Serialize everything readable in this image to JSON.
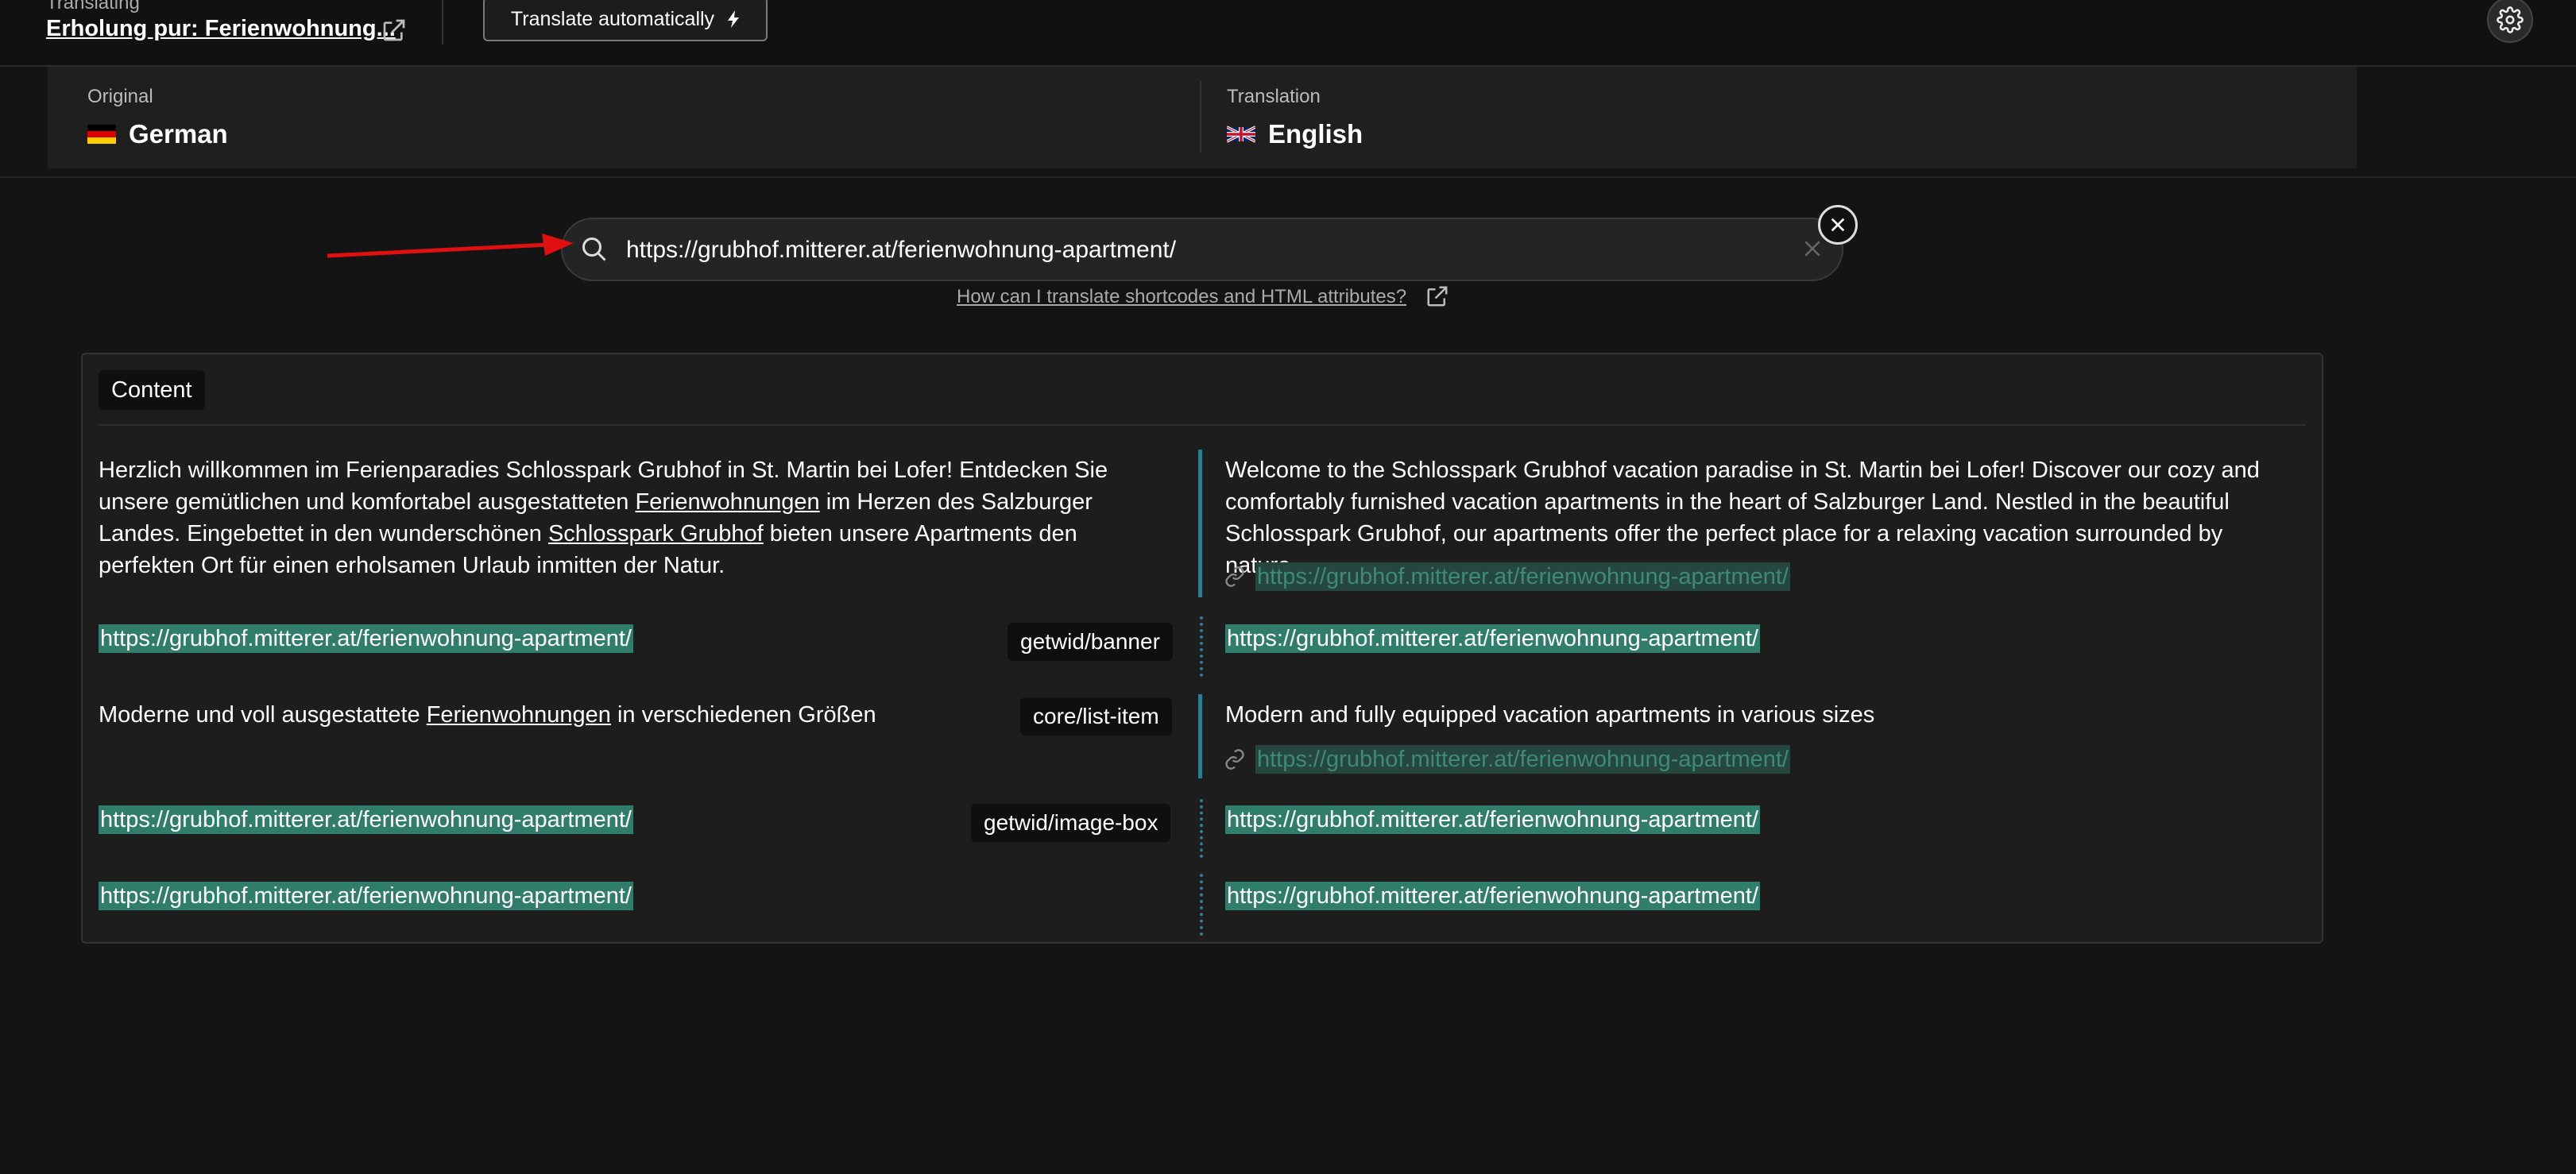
{
  "header": {
    "translating_label": "Translating",
    "page_title": "Erholung pur: Ferienwohnung...",
    "translate_automatically_label": "Translate automatically",
    "settings_icon": "gear-icon",
    "open_page_icon": "external-link-icon"
  },
  "languages": {
    "original_caption": "Original",
    "original_name": "German",
    "translation_caption": "Translation",
    "translation_name": "English"
  },
  "search": {
    "value": "https://grubhof.mitterer.at/ferienwohnung-apartment/",
    "help_link": "How can I translate shortcodes and HTML attributes?"
  },
  "content": {
    "tab_label": "Content",
    "rows": [
      {
        "original_parts": [
          "Herzlich willkommen im Ferienparadies Schlosspark Grubhof in St. Martin bei Lofer! Entdecken Sie unsere gemütlichen und komfortabel ausgestatteten ",
          "Ferienwohnungen",
          " im Herzen des Salzburger Landes. Eingebettet in den wunderschönen ",
          "Schlosspark Grubhof",
          " bieten unsere Apartments den perfekten Ort für einen erholsamen Urlaub inmitten der Natur."
        ],
        "translation": "Welcome to the Schlosspark Grubhof vacation paradise in St. Martin bei Lofer! Discover our cozy and comfortably furnished vacation apartments in the heart of Salzburger Land. Nestled in the beautiful Schlosspark Grubhof, our apartments offer the perfect place for a relaxing vacation surrounded by nature.",
        "translation_link": "https://grubhof.mitterer.at/ferienwohnung-apartment/"
      },
      {
        "tag": "getwid/banner",
        "original_url": "https://grubhof.mitterer.at/ferienwohnung-apartment/",
        "translation_url": "https://grubhof.mitterer.at/ferienwohnung-apartment/"
      },
      {
        "tag": "core/list-item",
        "original_parts": [
          "Moderne und voll ausgestattete ",
          "Ferienwohnungen",
          " in verschiedenen Größen"
        ],
        "translation": "Modern and fully equipped vacation apartments in various sizes",
        "translation_link": "https://grubhof.mitterer.at/ferienwohnung-apartment/"
      },
      {
        "tag": "getwid/image-box",
        "original_url": "https://grubhof.mitterer.at/ferienwohnung-apartment/",
        "translation_url": "https://grubhof.mitterer.at/ferienwohnung-apartment/"
      },
      {
        "original_url": "https://grubhof.mitterer.at/ferienwohnung-apartment/",
        "translation_url": "https://grubhof.mitterer.at/ferienwohnung-apartment/"
      }
    ]
  },
  "colors": {
    "background": "#141414",
    "highlight": "#2f7d6a",
    "divider_accent": "#2f7d8f",
    "annotation_arrow": "#e01010"
  }
}
